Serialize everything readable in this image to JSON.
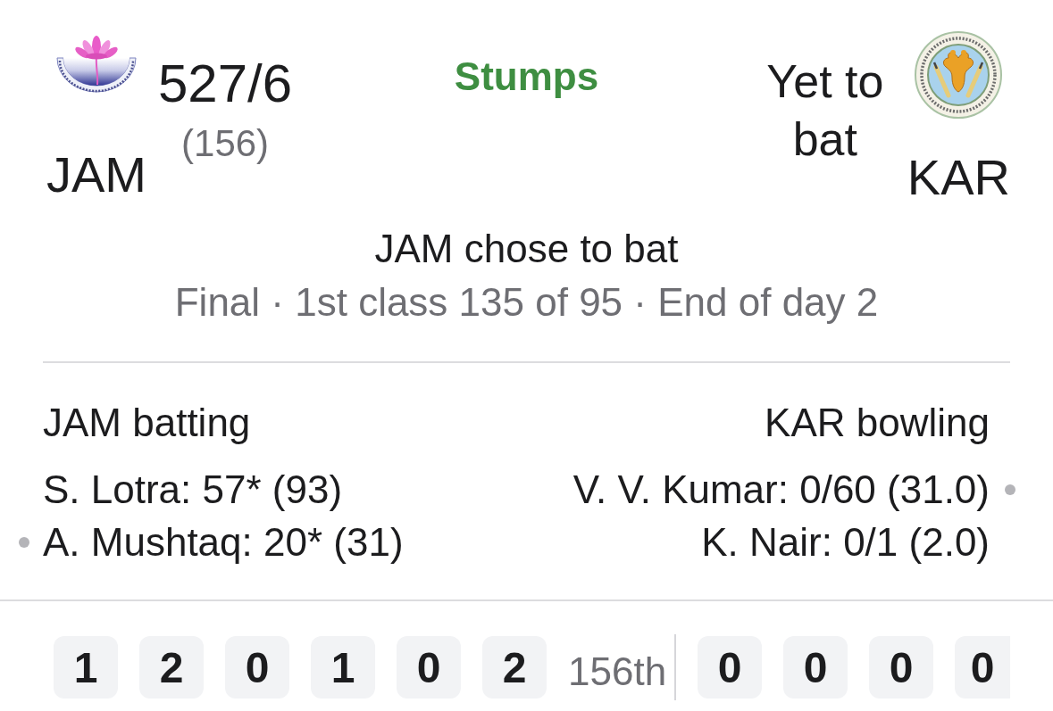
{
  "score_header": {
    "home": {
      "name": "JAM",
      "score": "527/6",
      "overs": "(156)"
    },
    "status": "Stumps",
    "away": {
      "name": "KAR",
      "status": "Yet to bat"
    }
  },
  "toss": "JAM chose to bat",
  "match_info": "Final · 1st class 135 of 95 · End of day 2",
  "batting": {
    "title": "JAM batting",
    "players": [
      {
        "text": "S. Lotra: 57* (93)",
        "on_strike": false
      },
      {
        "text": "A. Mushtaq: 20* (31)",
        "on_strike": true
      }
    ]
  },
  "bowling": {
    "title": "KAR bowling",
    "players": [
      {
        "text": "V. V. Kumar: 0/60 (31.0)",
        "on_strike": true
      },
      {
        "text": "K. Nair: 0/1 (2.0)",
        "on_strike": false
      }
    ]
  },
  "recent_balls": {
    "previous_over": [
      "1",
      "2",
      "0",
      "1",
      "0",
      "2"
    ],
    "over_label": "156th",
    "current_over": [
      "0",
      "0",
      "0",
      "0"
    ]
  }
}
